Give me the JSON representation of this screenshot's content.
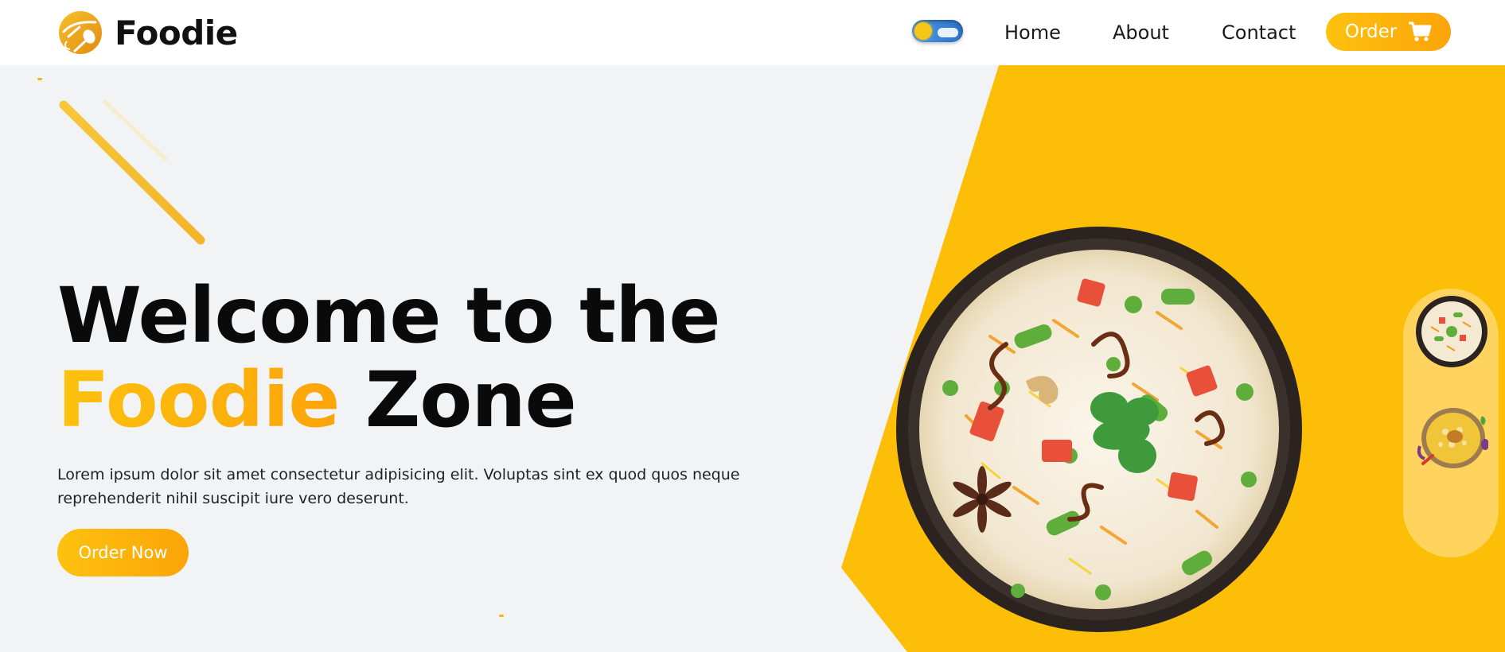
{
  "navbar": {
    "brand_name": "Foodie",
    "links": [
      "Home",
      "About",
      "Contact"
    ],
    "order_label": "Order",
    "theme": "light"
  },
  "hero": {
    "title_line1": "Welcome to the",
    "title_accent": "Foodie",
    "title_rest": "Zone",
    "description": "Lorem ipsum dolor sit amet consectetur adipisicing elit. Voluptas sint ex quod quos neque reprehenderit nihil suscipit iure vero deserunt.",
    "cta_label": "Order Now"
  },
  "thumbnails": [
    "biryani-bowl",
    "biryani-plate"
  ],
  "colors": {
    "accent": "#fcbf0a",
    "accent_gradient_end": "#fca40a",
    "panel": "#ffd45e",
    "hero_bg": "#f2f3f5",
    "text_dark": "#0a0a0a"
  },
  "icons": {
    "logo": "fork-spoon-icon",
    "cart": "shopping-cart-icon",
    "theme_toggle": "sun-cloud-toggle"
  }
}
